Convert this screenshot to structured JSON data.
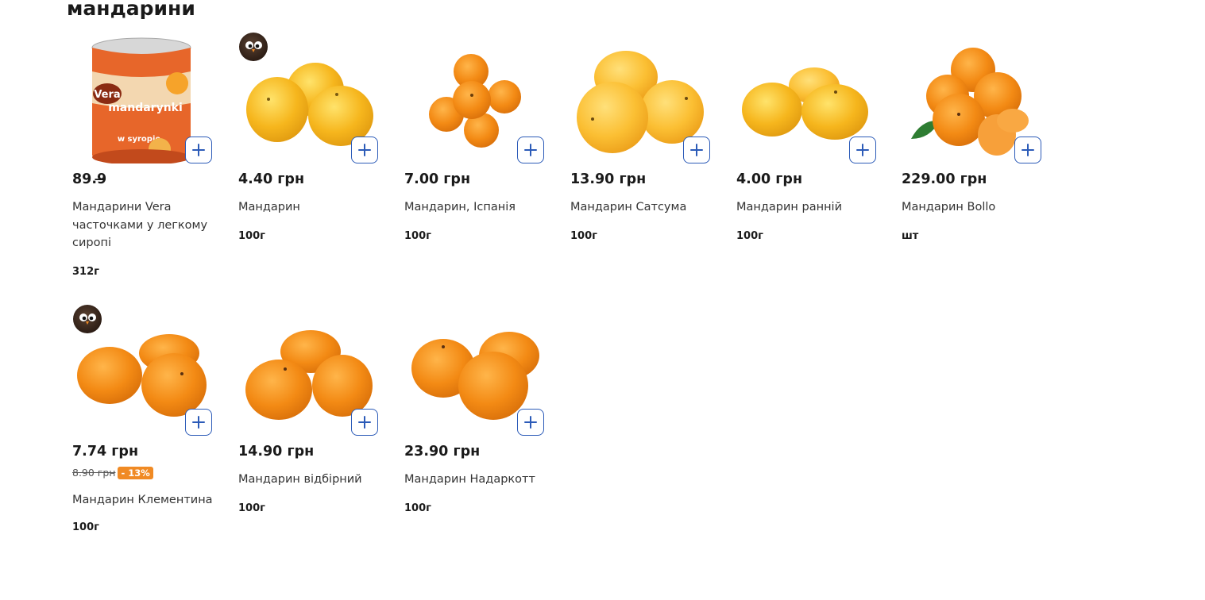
{
  "section": {
    "title": "мандарини"
  },
  "colors": {
    "accent": "#2c5bb8",
    "discount": "#f08a24",
    "orange": "#f7931e",
    "yellow": "#f6b61d"
  },
  "products": [
    {
      "price": "89.9̶̶",
      "name": "Мандарини Vera часточками у легкому сиропі",
      "weight": "312г",
      "image": "canned-mandarins",
      "badge": false
    },
    {
      "price": "4.40 грн",
      "name": "Мандарин",
      "weight": "100г",
      "image": "yellow-mandarins",
      "badge": true
    },
    {
      "price": "7.00 грн",
      "name": "Мандарин, Іспанія",
      "weight": "100г",
      "image": "small-mandarins",
      "badge": false
    },
    {
      "price": "13.90 грн",
      "name": "Мандарин Сатсума",
      "weight": "100г",
      "image": "satsuma-mandarins",
      "badge": false
    },
    {
      "price": "4.00 грн",
      "name": "Мандарин ранній",
      "weight": "100г",
      "image": "early-mandarins",
      "badge": false
    },
    {
      "price": "229.00 грн",
      "name": "Мандарин Bollo",
      "weight": "шт",
      "image": "bollo-mandarins",
      "badge": false
    },
    {
      "price": "7.74 грн",
      "old_price": "8.90 грн",
      "discount": "- 13%",
      "name": "Мандарин Клементина",
      "weight": "100г",
      "image": "clementines",
      "badge": true
    },
    {
      "price": "14.90 грн",
      "name": "Мандарин відбірний",
      "weight": "100г",
      "image": "select-mandarins",
      "badge": false
    },
    {
      "price": "23.90 грн",
      "name": "Мандарин Надаркотт",
      "weight": "100г",
      "image": "nadorcott-mandarins",
      "badge": false
    }
  ]
}
